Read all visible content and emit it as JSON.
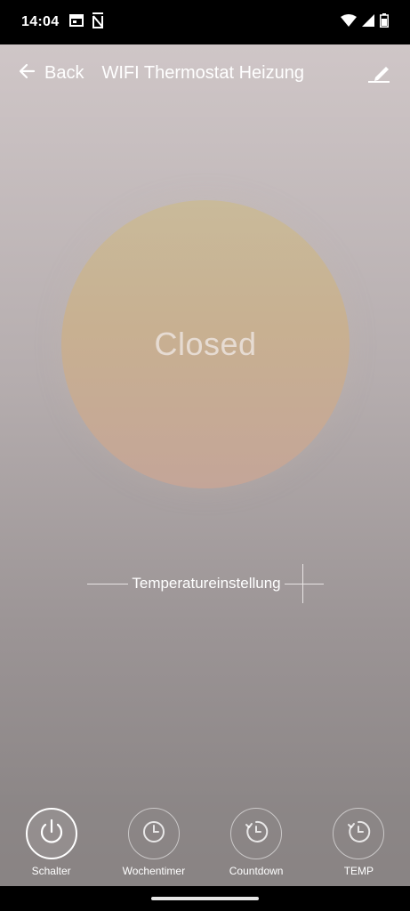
{
  "status_bar": {
    "time": "14:04",
    "icons": [
      "calendar-icon",
      "n-notification-icon",
      "wifi-icon",
      "signal-icon",
      "battery-icon"
    ]
  },
  "header": {
    "back_label": "Back",
    "title": "WIFI Thermostat Heizung"
  },
  "main": {
    "power_status": "Closed",
    "temp_setting_label": "Temperatureinstellung"
  },
  "bottom_nav": {
    "items": [
      {
        "label": "Schalter",
        "icon": "power-icon",
        "active": true
      },
      {
        "label": "Wochentimer",
        "icon": "clock-icon",
        "active": false
      },
      {
        "label": "Countdown",
        "icon": "countdown-icon",
        "active": false
      },
      {
        "label": "TEMP",
        "icon": "countdown-icon",
        "active": false
      }
    ]
  },
  "colors": {
    "circle_top": "#c9ba9a",
    "circle_bottom": "#c4a598",
    "background_top": "#cfc6c7",
    "background_bottom": "#858080"
  }
}
